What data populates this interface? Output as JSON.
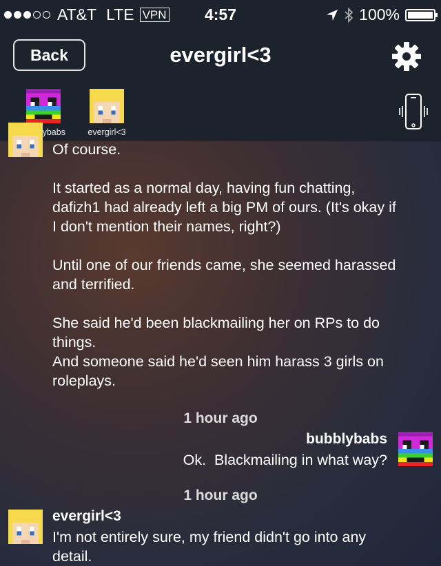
{
  "status_bar": {
    "carrier": "AT&T",
    "network": "LTE",
    "vpn": "VPN",
    "time": "4:57",
    "battery": "100%",
    "battery_level": 1.0
  },
  "nav": {
    "back_label": "Back",
    "title": "evergirl<3"
  },
  "participants": [
    {
      "name": "bubblybabs",
      "avatar": "rainbow-pixel-avatar"
    },
    {
      "name": "evergirl<3",
      "avatar": "blonde-pixel-avatar"
    }
  ],
  "messages": {
    "m1_lines": [
      "Of course.",
      "It started as a normal day, having fun chatting,",
      "dafizh1 had already left a big PM of ours. (It's okay if",
      "I don't mention their names, right?)",
      "Until one of our friends came, she seemed harassed",
      "and terrified.",
      "She said he'd been blackmailing her on RPs to do",
      "things.",
      "And someone said he'd seen him harass 3 girls on",
      "roleplays."
    ],
    "ts1": "1 hour ago",
    "m2_sender": "bubblybabs",
    "m2_text": "Ok.  Blackmailing in what way?",
    "ts2": "1 hour ago",
    "m3_sender": "evergirl<3",
    "m3_lines": [
      "I'm not entirely sure, my friend didn't go into any",
      "detail."
    ]
  },
  "colors": {
    "nav_bg": "#1d232d",
    "background_warm": "#5a3a2e",
    "background_cool": "#20263a"
  }
}
